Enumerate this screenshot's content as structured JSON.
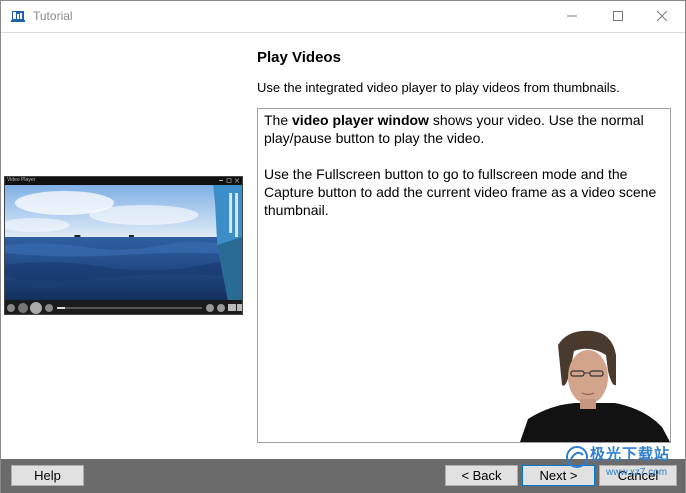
{
  "window": {
    "title": "Tutorial",
    "icons": {
      "app": "tutorial-app-icon",
      "minimize": "minimize-icon",
      "maximize": "maximize-icon",
      "close": "close-icon"
    }
  },
  "page": {
    "heading": "Play Videos",
    "subheading": "Use the integrated video player to play videos from thumbnails."
  },
  "description": {
    "p1_pre": "The ",
    "p1_bold": "video player window",
    "p1_post": " shows your video. Use the normal play/pause button to play the video.",
    "p2": "Use the Fullscreen button to go to fullscreen mode and the Capture button to add the current video frame as a video scene thumbnail."
  },
  "preview": {
    "window_title": "Video Player"
  },
  "footer": {
    "help": "Help",
    "back": "< Back",
    "next": "Next >",
    "cancel": "Cancel"
  },
  "watermark": {
    "text": "极光下载站",
    "url": "www.xz7.com"
  },
  "colors": {
    "footer_bg": "#6b6b6b",
    "button_bg": "#e1e1e1",
    "default_button_border": "#0078d7",
    "watermark": "#2f7fd0"
  }
}
